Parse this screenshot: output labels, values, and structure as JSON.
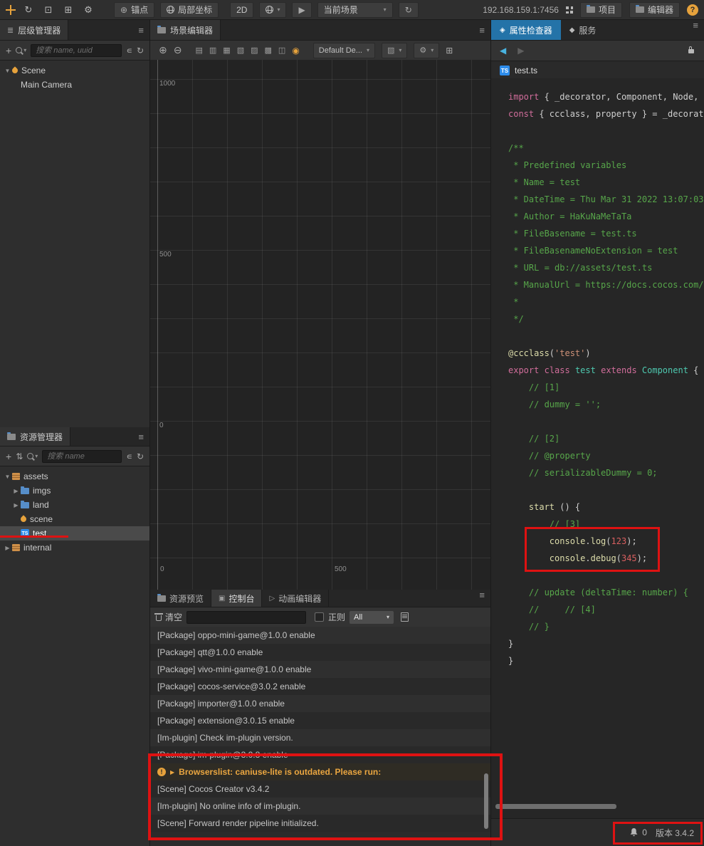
{
  "colors": {
    "accent_blue": "#2473a8",
    "warn_orange": "#e6a23c",
    "annotation_red": "#de1212",
    "selection": "#4a4a4a",
    "ts_blue": "#2d8ceb"
  },
  "topbar": {
    "anchor": "锚点",
    "local_coords": "局部坐标",
    "mode_2d": "2D",
    "scene_select": "当前场景",
    "address": "192.168.159.1:7456",
    "project": "项目",
    "editor": "编辑器",
    "help": "?"
  },
  "hierarchy": {
    "title": "层级管理器",
    "search_placeholder": "搜索 name, uuid",
    "tree": [
      {
        "label": "Scene",
        "depth": 0,
        "expander": "down",
        "icon": "scene"
      },
      {
        "label": "Main Camera",
        "depth": 1,
        "expander": "none",
        "icon": "none"
      }
    ]
  },
  "assets": {
    "title": "资源管理器",
    "search_placeholder": "搜索 name",
    "tree": [
      {
        "label": "assets",
        "depth": 0,
        "expander": "down",
        "icon": "pack"
      },
      {
        "label": "imgs",
        "depth": 1,
        "expander": "right",
        "icon": "folder"
      },
      {
        "label": "land",
        "depth": 1,
        "expander": "right",
        "icon": "folder"
      },
      {
        "label": "scene",
        "depth": 1,
        "expander": "none",
        "icon": "scene"
      },
      {
        "label": "test",
        "depth": 1,
        "expander": "none",
        "icon": "ts",
        "badge": "TS",
        "selected": true
      },
      {
        "label": "internal",
        "depth": 0,
        "expander": "right",
        "icon": "pack"
      }
    ]
  },
  "scene": {
    "title": "场景编辑器",
    "gizmo_dropdown": "Default De...",
    "ruler_y": [
      "1000",
      "500",
      "0"
    ],
    "ruler_x": [
      "0",
      "500"
    ]
  },
  "console": {
    "tabs": [
      {
        "label": "资源预览"
      },
      {
        "label": "控制台"
      },
      {
        "label": "动画编辑器"
      }
    ],
    "clear": "清空",
    "regex": "正则",
    "filter": "All",
    "logs": [
      {
        "text": "[Package] oppo-mini-game@1.0.0 enable"
      },
      {
        "text": "[Package] qtt@1.0.0 enable"
      },
      {
        "text": "[Package] vivo-mini-game@1.0.0 enable"
      },
      {
        "text": "[Package] cocos-service@3.0.2 enable"
      },
      {
        "text": "[Package] importer@1.0.0 enable"
      },
      {
        "text": "[Package] extension@3.0.15 enable"
      },
      {
        "text": "[Im-plugin] Check im-plugin version."
      },
      {
        "text": "[Package] im-plugin@3.0.8 enable"
      },
      {
        "text": "Browserslist: caniuse-lite is outdated. Please run:",
        "type": "warn"
      },
      {
        "text": "[Scene] Cocos Creator v3.4.2"
      },
      {
        "text": "[Im-plugin] No online info of im-plugin."
      },
      {
        "text": "[Scene] Forward render pipeline initialized."
      }
    ]
  },
  "inspector": {
    "tabs": [
      {
        "label": "属性检查器"
      },
      {
        "label": "服务"
      }
    ],
    "file_badge": "TS",
    "file_name": "test.ts",
    "code": [
      [
        [
          "kw",
          "import"
        ],
        [
          "pl",
          " { _decorator, Component, Node, "
        ]
      ],
      [
        [
          "kw",
          "const"
        ],
        [
          "pl",
          " { ccclass, property } = _decorator;"
        ]
      ],
      [],
      [
        [
          "cm",
          "/**"
        ]
      ],
      [
        [
          "cm",
          " * Predefined variables"
        ]
      ],
      [
        [
          "cm",
          " * Name = test"
        ]
      ],
      [
        [
          "cm",
          " * DateTime = Thu Mar 31 2022 13:07:03"
        ]
      ],
      [
        [
          "cm",
          " * Author = HaKuNaMeTaTa"
        ]
      ],
      [
        [
          "cm",
          " * FileBasename = test.ts"
        ]
      ],
      [
        [
          "cm",
          " * FileBasenameNoExtension = test"
        ]
      ],
      [
        [
          "cm",
          " * URL = db://assets/test.ts"
        ]
      ],
      [
        [
          "cm",
          " * ManualUrl = https://docs.cocos.com/"
        ]
      ],
      [
        [
          "cm",
          " *"
        ]
      ],
      [
        [
          "cm",
          " */"
        ]
      ],
      [],
      [
        [
          "dec",
          "@ccclass"
        ],
        [
          "pl",
          "("
        ],
        [
          "str",
          "'test'"
        ],
        [
          "pl",
          ")"
        ]
      ],
      [
        [
          "kw",
          "export"
        ],
        [
          "pl",
          " "
        ],
        [
          "kw",
          "class"
        ],
        [
          "pl",
          " "
        ],
        [
          "cls",
          "test"
        ],
        [
          "pl",
          " "
        ],
        [
          "kw",
          "extends"
        ],
        [
          "pl",
          " "
        ],
        [
          "cls",
          "Component"
        ],
        [
          "pl",
          " {"
        ]
      ],
      [
        [
          "cm",
          "    // [1]"
        ]
      ],
      [
        [
          "cm",
          "    // dummy = '';"
        ]
      ],
      [],
      [
        [
          "cm",
          "    // [2]"
        ]
      ],
      [
        [
          "cm",
          "    // @property"
        ]
      ],
      [
        [
          "cm",
          "    // serializableDummy = 0;"
        ]
      ],
      [],
      [
        [
          "pl",
          "    "
        ],
        [
          "fn",
          "start"
        ],
        [
          "pl",
          " () {"
        ]
      ],
      [
        [
          "cm",
          "        // [3]"
        ]
      ],
      [
        [
          "pl",
          "        "
        ],
        [
          "fn",
          "console"
        ],
        [
          "pl",
          "."
        ],
        [
          "fn",
          "log"
        ],
        [
          "pl",
          "("
        ],
        [
          "num",
          "123"
        ],
        [
          "pl",
          ");"
        ]
      ],
      [
        [
          "pl",
          "        "
        ],
        [
          "fn",
          "console"
        ],
        [
          "pl",
          "."
        ],
        [
          "fn",
          "debug"
        ],
        [
          "pl",
          "("
        ],
        [
          "num",
          "345"
        ],
        [
          "pl",
          ");"
        ]
      ],
      [],
      [
        [
          "cm",
          "    // update (deltaTime: number) {"
        ]
      ],
      [
        [
          "cm",
          "    //     // [4]"
        ]
      ],
      [
        [
          "cm",
          "    // }"
        ]
      ],
      [
        [
          "pl",
          "}"
        ]
      ],
      [
        [
          "pl",
          "}"
        ]
      ]
    ]
  },
  "statusbar": {
    "count": "0",
    "version": "版本 3.4.2"
  }
}
